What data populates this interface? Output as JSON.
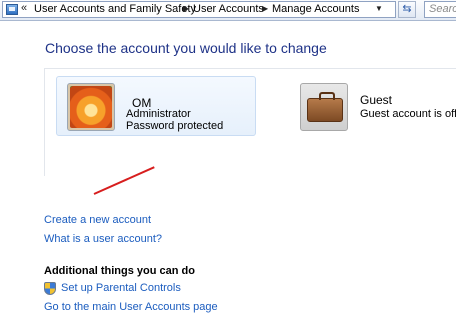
{
  "address_bar": {
    "breadcrumbs": [
      "User Accounts and Family Safety",
      "User Accounts",
      "Manage Accounts"
    ],
    "search_placeholder": "Searc"
  },
  "main": {
    "heading": "Choose the account you would like to change",
    "accounts": [
      {
        "name": "OM",
        "line1": "Administrator",
        "line2": "Password protected",
        "icon": "flower-picture"
      },
      {
        "name": "Guest",
        "line1": "Guest account is off",
        "icon": "briefcase-picture"
      }
    ],
    "links": {
      "create": "Create a new account",
      "what_is": "What is a user account?"
    },
    "additional": {
      "heading": "Additional things you can do",
      "parental": "Set up Parental Controls",
      "main_page": "Go to the main User Accounts page"
    }
  },
  "colors": {
    "heading": "#1e3287",
    "link": "#1c5dbf",
    "annotation": "#d71e1e"
  }
}
